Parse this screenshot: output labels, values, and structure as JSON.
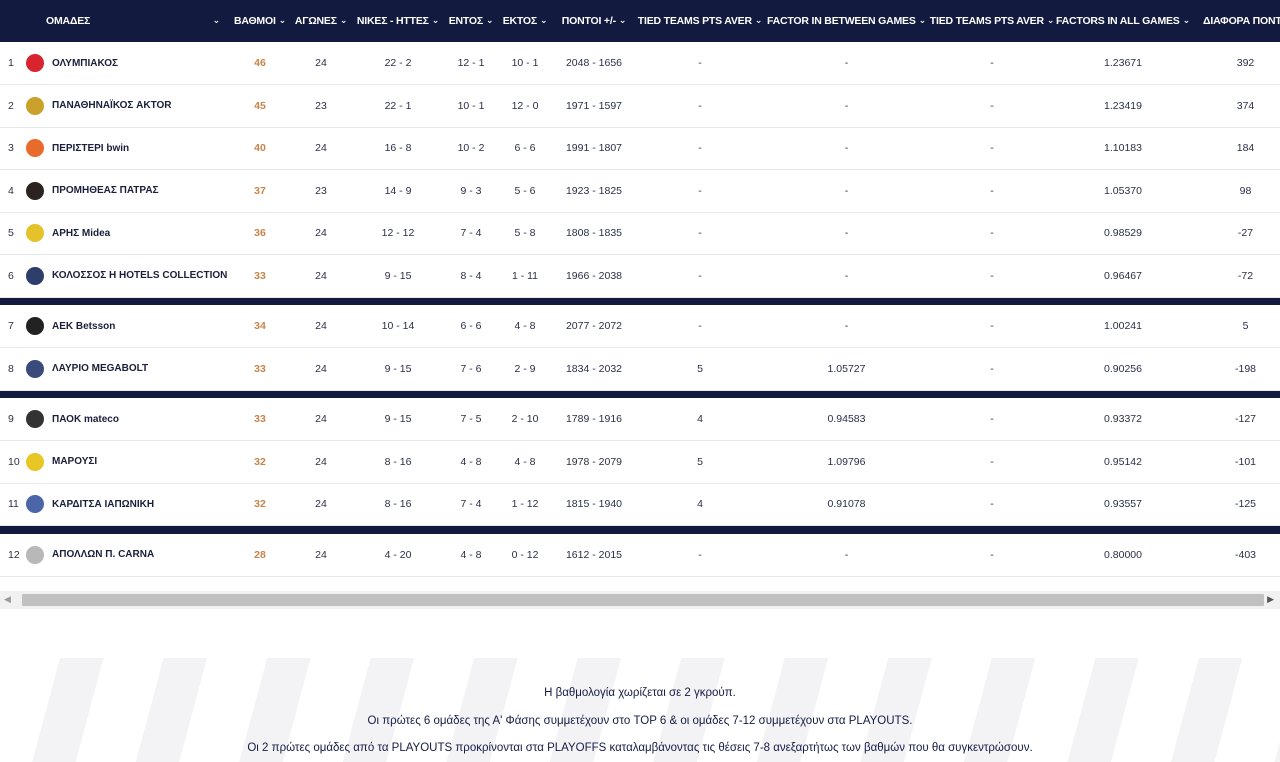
{
  "headers": {
    "team": "ΟΜΑΔΕΣ",
    "points": "ΒΑΘΜΟΙ",
    "games": "ΑΓΩΝΕΣ",
    "wl": "ΝΙΚΕΣ - ΗΤΤΕΣ",
    "home": "ΕΝΤΟΣ",
    "away": "ΕΚΤΟΣ",
    "score": "ΠΟΝΤΟΙ +/-",
    "tied1": "TIED TEAMS PTS AVER",
    "factor_between": "FACTOR IN BETWEEN GAMES",
    "tied2": "TIED TEAMS PTS AVER",
    "factor_all": "FACTORS IN ALL GAMES",
    "diff": "ΔΙΑΦΟΡΑ ΠΟΝΤΩΝ"
  },
  "icons": {
    "sort": "chevron-down-icon",
    "scroll_left": "arrow-left-icon",
    "scroll_right": "arrow-right-icon"
  },
  "colors": {
    "header_bg": "#121a3f",
    "points": "#c7834a"
  },
  "groups": [
    [
      {
        "pos": "1",
        "team": "ΟΛΥΜΠΙΑΚΟΣ",
        "logo": "#d8242f",
        "pts": "46",
        "games": "24",
        "wl": "22 - 2",
        "home": "12 - 1",
        "away": "10 - 1",
        "score": "2048 - 1656",
        "tied1": "-",
        "fbg": "-",
        "tied2": "-",
        "fall": "1.23671",
        "diff": "392"
      },
      {
        "pos": "2",
        "team": "ΠΑΝΑΘΗΝΑΪΚΟΣ AKTOR",
        "logo": "#c9a12b",
        "pts": "45",
        "games": "23",
        "wl": "22 - 1",
        "home": "10 - 1",
        "away": "12 - 0",
        "score": "1971 - 1597",
        "tied1": "-",
        "fbg": "-",
        "tied2": "-",
        "fall": "1.23419",
        "diff": "374"
      },
      {
        "pos": "3",
        "team": "ΠΕΡΙΣΤΕΡΙ bwin",
        "logo": "#e86b2c",
        "pts": "40",
        "games": "24",
        "wl": "16 - 8",
        "home": "10 - 2",
        "away": "6 - 6",
        "score": "1991 - 1807",
        "tied1": "-",
        "fbg": "-",
        "tied2": "-",
        "fall": "1.10183",
        "diff": "184"
      },
      {
        "pos": "4",
        "team": "ΠΡΟΜΗΘΕΑΣ ΠΑΤΡΑΣ",
        "logo": "#2a2320",
        "pts": "37",
        "games": "23",
        "wl": "14 - 9",
        "home": "9 - 3",
        "away": "5 - 6",
        "score": "1923 - 1825",
        "tied1": "-",
        "fbg": "-",
        "tied2": "-",
        "fall": "1.05370",
        "diff": "98"
      },
      {
        "pos": "5",
        "team": "ΑΡΗΣ Midea",
        "logo": "#e5c22a",
        "pts": "36",
        "games": "24",
        "wl": "12 - 12",
        "home": "7 - 4",
        "away": "5 - 8",
        "score": "1808 - 1835",
        "tied1": "-",
        "fbg": "-",
        "tied2": "-",
        "fall": "0.98529",
        "diff": "-27"
      },
      {
        "pos": "6",
        "team": "ΚΟΛΟΣΣΟΣ H HOTELS COLLECTION",
        "logo": "#2d3e6b",
        "pts": "33",
        "games": "24",
        "wl": "9 - 15",
        "home": "8 - 4",
        "away": "1 - 11",
        "score": "1966 - 2038",
        "tied1": "-",
        "fbg": "-",
        "tied2": "-",
        "fall": "0.96467",
        "diff": "-72"
      }
    ],
    [
      {
        "pos": "7",
        "team": "ΑΕΚ Betsson",
        "logo": "#222222",
        "pts": "34",
        "games": "24",
        "wl": "10 - 14",
        "home": "6 - 6",
        "away": "4 - 8",
        "score": "2077 - 2072",
        "tied1": "-",
        "fbg": "-",
        "tied2": "-",
        "fall": "1.00241",
        "diff": "5"
      },
      {
        "pos": "8",
        "team": "ΛΑΥΡΙΟ MEGABOLT",
        "logo": "#3a4a7a",
        "pts": "33",
        "games": "24",
        "wl": "9 - 15",
        "home": "7 - 6",
        "away": "2 - 9",
        "score": "1834 - 2032",
        "tied1": "5",
        "fbg": "1.05727",
        "tied2": "-",
        "fall": "0.90256",
        "diff": "-198"
      }
    ],
    [
      {
        "pos": "9",
        "team": "ΠΑΟΚ mateco",
        "logo": "#333333",
        "pts": "33",
        "games": "24",
        "wl": "9 - 15",
        "home": "7 - 5",
        "away": "2 - 10",
        "score": "1789 - 1916",
        "tied1": "4",
        "fbg": "0.94583",
        "tied2": "-",
        "fall": "0.93372",
        "diff": "-127"
      },
      {
        "pos": "10",
        "team": "ΜΑΡΟΥΣΙ",
        "logo": "#e8c625",
        "pts": "32",
        "games": "24",
        "wl": "8 - 16",
        "home": "4 - 8",
        "away": "4 - 8",
        "score": "1978 - 2079",
        "tied1": "5",
        "fbg": "1.09796",
        "tied2": "-",
        "fall": "0.95142",
        "diff": "-101"
      },
      {
        "pos": "11",
        "team": "ΚΑΡΔΙΤΣΑ ΙΑΠΩΝΙΚΗ",
        "logo": "#4a66a8",
        "pts": "32",
        "games": "24",
        "wl": "8 - 16",
        "home": "7 - 4",
        "away": "1 - 12",
        "score": "1815 - 1940",
        "tied1": "4",
        "fbg": "0.91078",
        "tied2": "-",
        "fall": "0.93557",
        "diff": "-125"
      }
    ],
    [
      {
        "pos": "12",
        "team": "ΑΠΟΛΛΩΝ Π. CARNA",
        "logo": "#b8b8b8",
        "pts": "28",
        "games": "24",
        "wl": "4 - 20",
        "home": "4 - 8",
        "away": "0 - 12",
        "score": "1612 - 2015",
        "tied1": "-",
        "fbg": "-",
        "tied2": "-",
        "fall": "0.80000",
        "diff": "-403"
      }
    ]
  ],
  "notes": [
    "Η βαθμολογία χωρίζεται σε 2 γκρούπ.",
    "Οι πρώτες 6 ομάδες της Α' Φάσης συμμετέχουν στο TOP 6 & οι ομάδες 7-12 συμμετέχουν στα PLAYOUTS.",
    "Οι 2 πρώτες ομάδες από τα PLAYOUTS προκρίνονται στα PLAYOFFS καταλαμβάνοντας τις θέσεις 7-8 ανεξαρτήτως των βαθμών που θα συγκεντρώσουν."
  ]
}
